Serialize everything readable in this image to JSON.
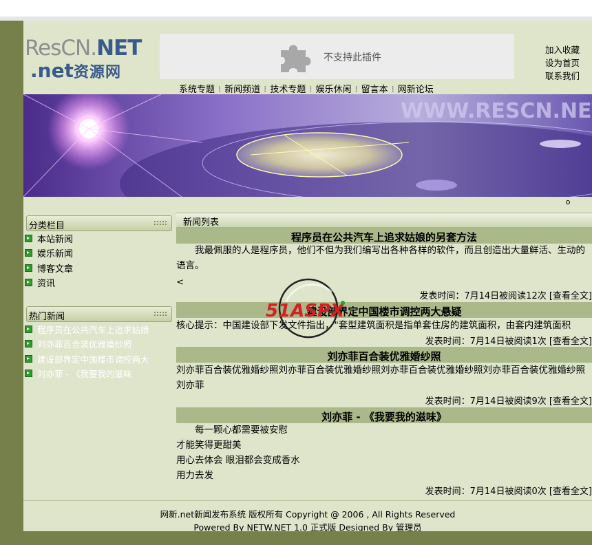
{
  "logo": {
    "part1": "ResCN.",
    "part2": "NET",
    "part3": ".net",
    "part4": "资源网"
  },
  "plugin": {
    "message": "不支持此插件"
  },
  "quicklinks": [
    "加入收藏",
    "设为首页",
    "联系我们"
  ],
  "nav": [
    "系统专题",
    "新闻频道",
    "技术专题",
    "娱乐休闲",
    "留言本",
    "网新论坛"
  ],
  "banner": {
    "watermark_text": "WWW.RESCN.NET"
  },
  "sidebar": {
    "category_title": "分类栏目",
    "categories": [
      "本站新闻",
      "娱乐新闻",
      "博客文章",
      "资讯"
    ],
    "hot_title": "热门新闻",
    "hot": [
      "程序员在公共汽车上追求姑娘",
      "刘亦菲百合装优雅婚纱照",
      "建设部界定中国楼市调控两大",
      "刘亦菲 - 《我要我的滋味"
    ]
  },
  "news": {
    "header": "新闻列表",
    "items": [
      {
        "title": "程序员在公共汽车上追求姑娘的另套方法",
        "body": [
          "　　我最佩服的人是程序员，他们不但为我们编写出各种各样的软件，而且创造出大量鲜活、生动的语言。",
          "<"
        ],
        "meta": "发表时间：7月14日被阅读12次 [查看全文]"
      },
      {
        "title": "建设部界定中国楼市调控两大悬疑",
        "body": [
          "核心提示：中国建设部下发文件指出，\"套型建筑面积是指单套住房的建筑面积，由套内建筑面积"
        ],
        "meta": "发表时间：7月14日被阅读1次 [查看全文]"
      },
      {
        "title": "刘亦菲百合装优雅婚纱照",
        "body": [
          "刘亦菲百合装优雅婚纱照刘亦菲百合装优雅婚纱照刘亦菲百合装优雅婚纱照刘亦菲百合装优雅婚纱照刘亦菲"
        ],
        "meta": "发表时间：7月14日被阅读9次 [查看全文]"
      },
      {
        "title": "刘亦菲 - 《我要我的滋味》",
        "body": [
          "　　每一颗心都需要被安慰",
          "才能笑得更甜美",
          "用心去体会 眼泪都会变成香水",
          "用力去发"
        ],
        "meta": "发表时间：7月14日被阅读0次 [查看全文]"
      }
    ]
  },
  "footer": {
    "line1": "网新.net新闻发布系统  版权所有 Copyright @ 2006 , All Rights Reserved",
    "line2": "Powered By NETW.NET 1.0 正式版    Designed By 管理员"
  },
  "overlay_logo": {
    "text": "51ASPX"
  },
  "colors": {
    "sidebar_strip": "#76804a",
    "page_bg": "#dee5cb",
    "title_bar": "#aab88a"
  }
}
